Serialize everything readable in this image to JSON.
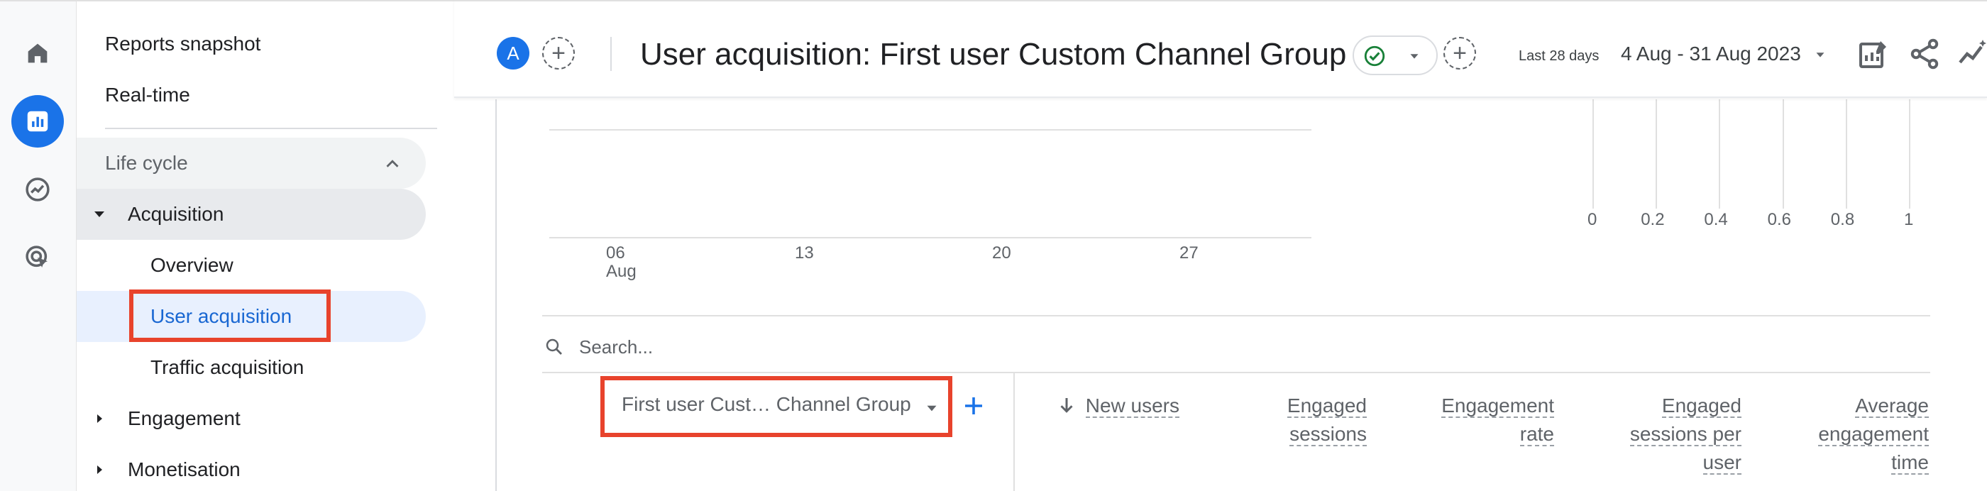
{
  "rail": {
    "items": [
      {
        "name": "home-icon"
      },
      {
        "name": "reports-icon",
        "active": true
      },
      {
        "name": "explore-icon"
      },
      {
        "name": "advertising-icon"
      }
    ]
  },
  "nav": {
    "reports_snapshot": "Reports snapshot",
    "realtime": "Real-time",
    "section": "Life cycle",
    "acquisition": "Acquisition",
    "overview": "Overview",
    "user_acquisition": "User acquisition",
    "traffic_acquisition": "Traffic acquisition",
    "engagement": "Engagement",
    "monetisation": "Monetisation"
  },
  "header": {
    "avatar": "A",
    "title": "User acquisition: First user Custom Channel Group",
    "date_label": "Last 28 days",
    "date_range": "4 Aug - 31 Aug 2023"
  },
  "chart": {
    "x_ticks": [
      {
        "label": "06",
        "sub": "Aug"
      },
      {
        "label": "13",
        "sub": ""
      },
      {
        "label": "20",
        "sub": ""
      },
      {
        "label": "27",
        "sub": ""
      }
    ],
    "bar_ticks": [
      "0",
      "0.2",
      "0.4",
      "0.6",
      "0.8",
      "1"
    ]
  },
  "table": {
    "search_placeholder": "Search...",
    "dimension": "First user Cust… Channel Group",
    "metrics": [
      {
        "lines": [
          "New users"
        ],
        "sorted": true
      },
      {
        "lines": [
          "Engaged",
          "sessions"
        ]
      },
      {
        "lines": [
          "Engagement",
          "rate"
        ]
      },
      {
        "lines": [
          "Engaged",
          "sessions per",
          "user"
        ]
      },
      {
        "lines": [
          "Average",
          "engagement",
          "time"
        ]
      }
    ]
  },
  "colors": {
    "accent": "#1a73e8",
    "highlight": "#e8432c",
    "success": "#188038"
  }
}
